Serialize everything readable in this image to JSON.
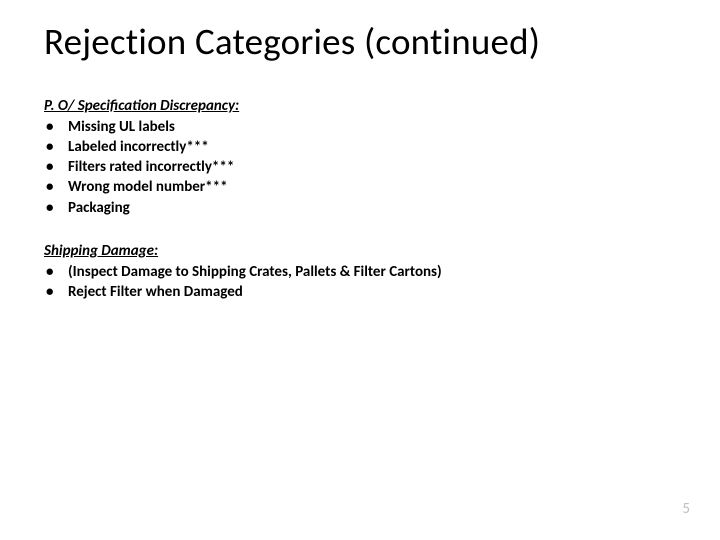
{
  "title": "Rejection Categories (continued)",
  "sections": [
    {
      "heading": "P. O/ Specification Discrepancy:",
      "items": [
        "Missing UL labels",
        "Labeled incorrectly***",
        "Filters rated incorrectly***",
        "Wrong model number***",
        "Packaging"
      ]
    },
    {
      "heading": "Shipping Damage:",
      "items": [
        "(Inspect Damage to Shipping Crates, Pallets & Filter Cartons)",
        " Reject Filter when Damaged"
      ]
    }
  ],
  "page_number": "5"
}
